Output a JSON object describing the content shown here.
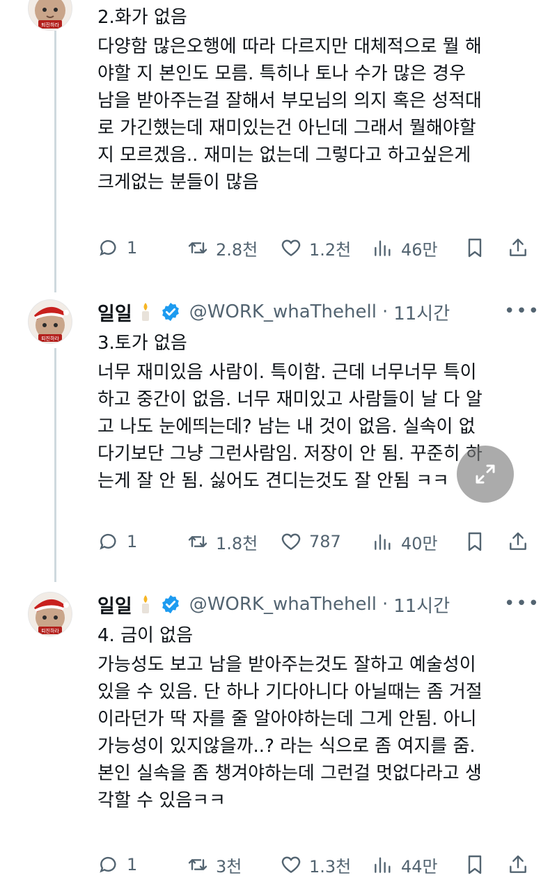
{
  "tweets": [
    {
      "author": "",
      "handle": "",
      "time": "",
      "avatar_text": "퇴진하라",
      "lines": [
        "2.화가 없음",
        "다양함 많은오행에 따라 다르지만 대체적으로 뭘 해",
        "야할 지 본인도 모름. 특히나 토나 수가 많은 경우",
        "남을 받아주는걸 잘해서 부모님의 의지 혹은 성적대",
        "로 가긴했는데 재미있는건 아닌데 그래서 뭘해야할",
        "지 모르겠음.. 재미는 없는데 그렇다고 하고싶은게",
        "크게없는 분들이 많음"
      ],
      "stats": {
        "replies": "1",
        "retweets": "2.8천",
        "likes": "1.2천",
        "views": "46만"
      }
    },
    {
      "author": "일일",
      "handle": "@WORK_whaThehell",
      "time": "11시간",
      "avatar_text": "퇴진하라",
      "lines": [
        "3.토가 없음",
        "너무 재미있음 사람이. 특이함. 근데 너무너무 특이",
        "하고 중간이 없음. 너무 재미있고 사람들이 날 다 알",
        "고 나도 눈에띄는데? 남는 내 것이 없음. 실속이 없",
        "다기보단 그냥 그런사람임. 저장이 안 됨. 꾸준히 하",
        "는게 잘 안 됨. 싫어도 견디는것도 잘 안됨 ㅋㅋ"
      ],
      "stats": {
        "replies": "1",
        "retweets": "1.8천",
        "likes": "787",
        "views": "40만"
      }
    },
    {
      "author": "일일",
      "handle": "@WORK_whaThehell",
      "time": "11시간",
      "avatar_text": "퇴진하라",
      "lines": [
        "4. 금이 없음",
        "가능성도 보고 남을 받아주는것도 잘하고 예술성이",
        "있을 수 있음. 단 하나 기다아니다 아닐때는 좀 거절",
        "이라던가 딱 자를 줄 알아야하는데 그게 안됨. 아니",
        "가능성이 있지않을까..? 라는 식으로 좀 여지를 줌.",
        "본인 실속을 좀 챙겨야하는데 그런걸 멋없다라고 생",
        "각할 수 있음ㅋㅋ"
      ],
      "stats": {
        "replies": "1",
        "retweets": "3천",
        "likes": "1.3천",
        "views": "44만"
      }
    }
  ],
  "colors": {
    "text": "#0f1419",
    "muted": "#536471",
    "verified": "#1d9bf0",
    "thread": "#cfd9de"
  }
}
